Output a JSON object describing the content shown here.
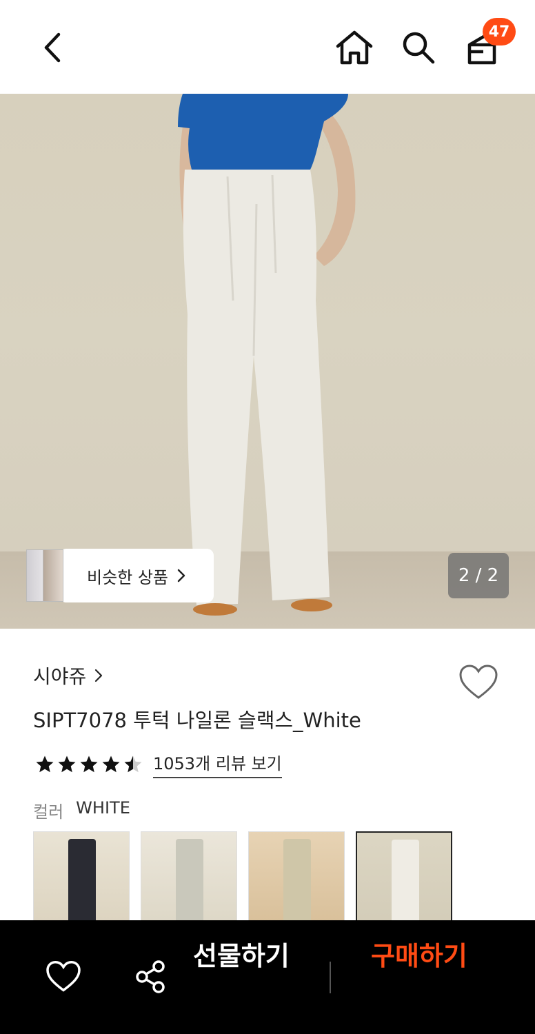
{
  "header": {
    "cart_count": "47",
    "icons": [
      "back-icon",
      "home-icon",
      "search-icon",
      "shopping-bag-icon"
    ]
  },
  "hero": {
    "similar_label": "비슷한 상품",
    "page_indicator": "2 / 2"
  },
  "product": {
    "brand": "시야쥬",
    "title": "SIPT7078 투턱 나일론 슬랙스_White",
    "rating": 4.5,
    "review_link": "1053개 리뷰 보기",
    "color_label": "컬러",
    "color_value": "WHITE",
    "swatches": [
      {
        "pant_color": "#2a2b33",
        "selected": false
      },
      {
        "pant_color": "#c9c8bb",
        "selected": false
      },
      {
        "pant_color": "#cfc6a8",
        "selected": false
      },
      {
        "pant_color": "#efece4",
        "selected": true
      }
    ]
  },
  "bottom_bar": {
    "gift_label": "선물하기",
    "buy_label": "구매하기",
    "accent_color": "#ff4b14"
  }
}
